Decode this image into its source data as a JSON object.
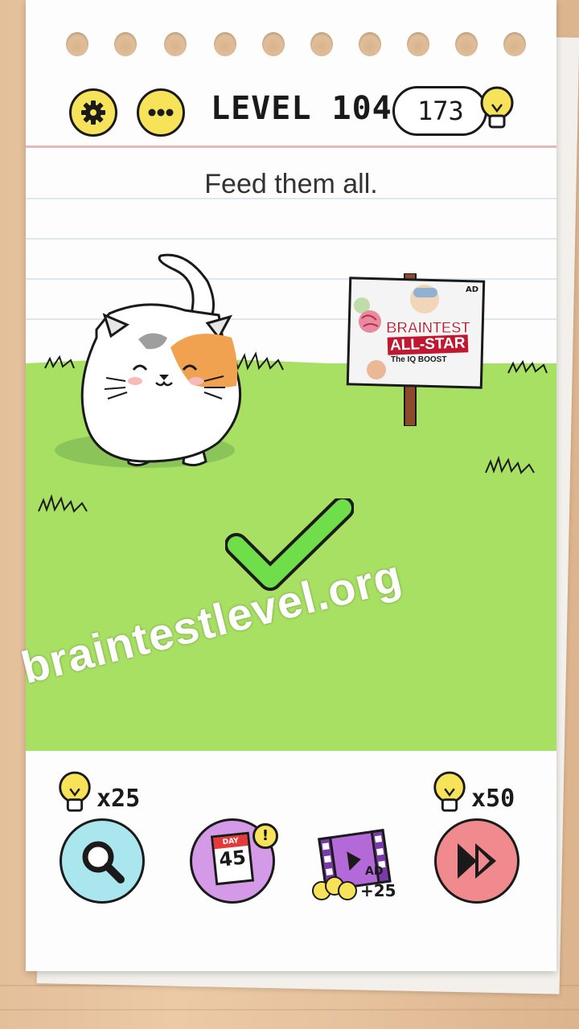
{
  "header": {
    "settings_icon": "gear-icon",
    "menu_icon": "more-dots-icon",
    "level_title": "LEVEL 104",
    "hint_count": "173",
    "hint_icon": "lightbulb-icon"
  },
  "question": "Feed them all.",
  "scene": {
    "ad_sign": {
      "badge": "AD",
      "title_line1": "BRAINTEST",
      "title_line2": "ALL-STAR",
      "subtitle": "The IQ BOOST"
    },
    "result_icon": "checkmark-icon"
  },
  "watermark": "braintestlevel.org",
  "toolbar": {
    "hint_cost": "x25",
    "skip_cost": "x50",
    "daily_badge_top": "DAY",
    "daily_day": "45",
    "daily_alert": "!",
    "video_badge": "AD",
    "video_reward": "+25",
    "colors": {
      "search": "#a9e6ee",
      "daily": "#d49ae8",
      "skip": "#f08a8f",
      "accent": "#f7e35a"
    }
  }
}
